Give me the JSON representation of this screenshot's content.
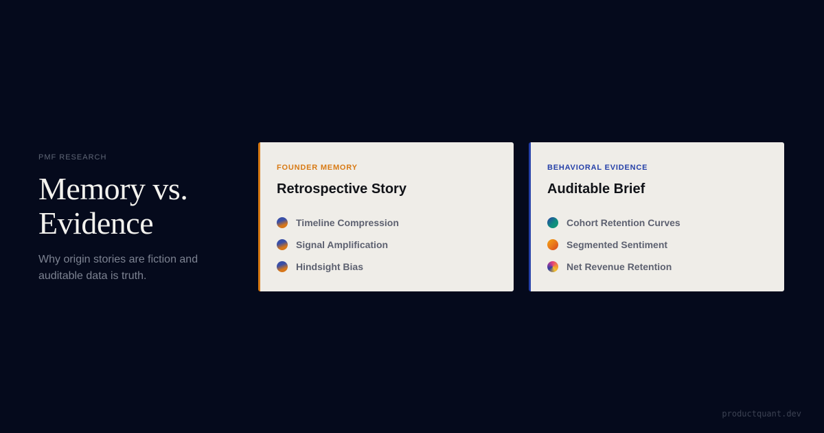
{
  "intro": {
    "eyebrow": "PMF RESEARCH",
    "title": "Memory vs. Evidence",
    "subtitle": "Why origin stories are fiction and auditable data is truth."
  },
  "cards": [
    {
      "eyebrow": "FOUNDER MEMORY",
      "title": "Retrospective Story",
      "accent_color": "#d87a14",
      "items": [
        {
          "label": "Timeline Compression",
          "icon": "bias-dot-icon"
        },
        {
          "label": "Signal Amplification",
          "icon": "bias-dot-icon"
        },
        {
          "label": "Hindsight Bias",
          "icon": "bias-dot-icon"
        }
      ]
    },
    {
      "eyebrow": "BEHAVIORAL EVIDENCE",
      "title": "Auditable Brief",
      "accent_color": "#2540a8",
      "items": [
        {
          "label": "Cohort Retention Curves",
          "icon": "retention-dot-icon"
        },
        {
          "label": "Segmented Sentiment",
          "icon": "sentiment-dot-icon"
        },
        {
          "label": "Net Revenue Retention",
          "icon": "revenue-dot-icon"
        }
      ]
    }
  ],
  "footer": {
    "site": "productquant.dev"
  }
}
